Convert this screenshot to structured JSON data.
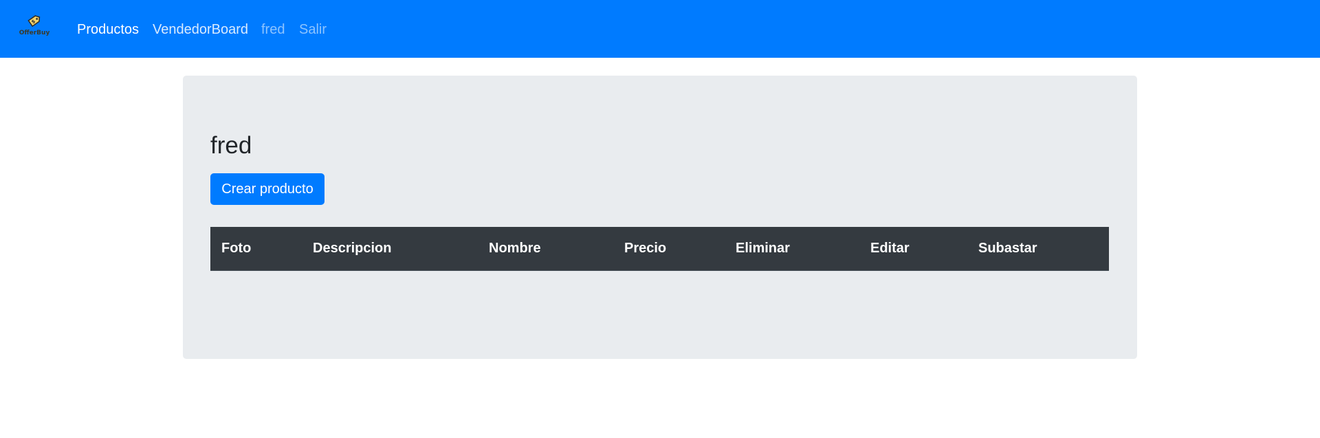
{
  "navbar": {
    "brand_text": "OfferBuy",
    "brand_color": "#007bff",
    "links": [
      {
        "label": "Productos",
        "state": "active"
      },
      {
        "label": "VendedorBoard",
        "state": "normal"
      },
      {
        "label": "fred",
        "state": "muted"
      },
      {
        "label": "Salir",
        "state": "muted"
      }
    ]
  },
  "main": {
    "title": "fred",
    "create_button_label": "Crear producto",
    "table": {
      "headers": [
        "Foto",
        "Descripcion",
        "Nombre",
        "Precio",
        "Eliminar",
        "Editar",
        "Subastar"
      ],
      "rows": []
    }
  },
  "colors": {
    "primary": "#007bff",
    "jumbotron_bg": "#e9ecef",
    "table_header_bg": "#343a40"
  },
  "icons": {
    "brand_logo": "price-tag-icon"
  }
}
